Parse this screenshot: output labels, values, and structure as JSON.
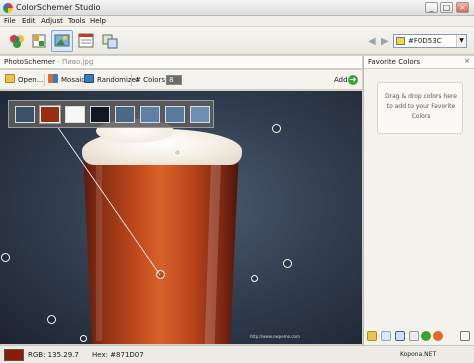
{
  "window": {
    "title": "ColorSchemer Studio",
    "buttons": [
      "_",
      "□",
      "×"
    ]
  },
  "menu": [
    "File",
    "Edit",
    "Adjust",
    "Tools",
    "Help"
  ],
  "toolbar": {
    "buttons": [
      "color-wheel-icon",
      "schemes-icon",
      "photoschemer-icon",
      "gallery-icon",
      "export-icon"
    ],
    "active": "photoschemer-icon",
    "hex_value": "#F0D53C",
    "hex_swatch_color": "#F0D53C"
  },
  "tab": {
    "name": "PhotoSchemer",
    "separator": " - ",
    "filename": "Пиво.jpg"
  },
  "subtoolbar": {
    "open": "Open...",
    "mosaic": "Mosaic",
    "randomize": "Randomize!",
    "colors_label": "# Colors:",
    "colors_value": "8",
    "add": "Add"
  },
  "palette": [
    "#3b5069",
    "#9b2c0f",
    "#f7f7f7",
    "#121823",
    "#4b6887",
    "#5c80a6",
    "#587a9e",
    "#6b8fb5"
  ],
  "photo": {
    "watermark": "http://www.nwpemo.com"
  },
  "status": {
    "rgb": "RGB: 135.29.7",
    "hex": "Hex: #871D07",
    "current_color": "#871D07",
    "brand": "Kopona.NET"
  },
  "favorites": {
    "title": "Favorite Colors",
    "close": "×",
    "hint": "Drag & drop colors here to add to your Favorite Colors"
  }
}
